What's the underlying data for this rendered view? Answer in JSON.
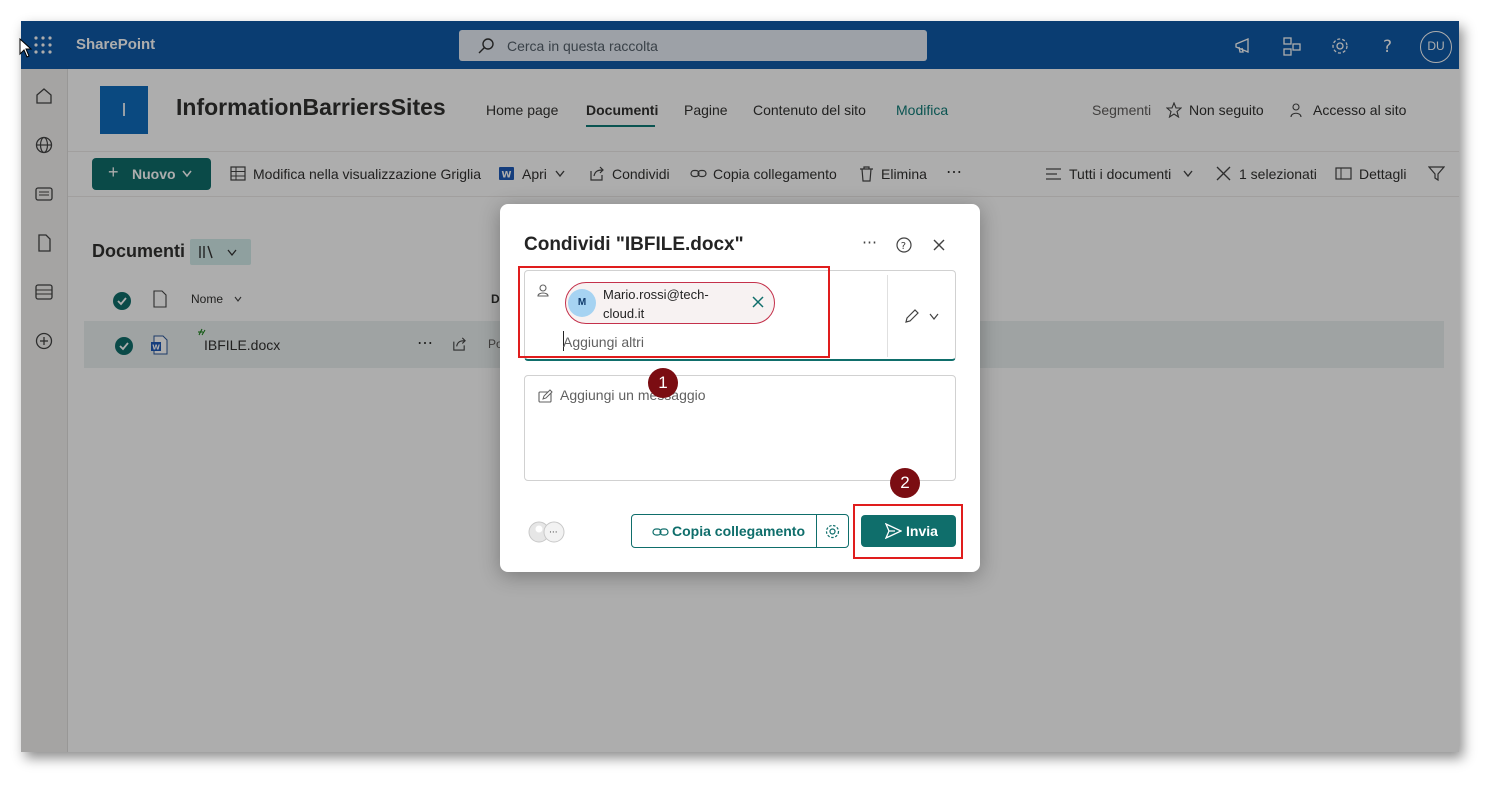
{
  "app": {
    "name": "SharePoint"
  },
  "search": {
    "placeholder": "Cerca in questa raccolta"
  },
  "user": {
    "initials": "DU"
  },
  "site": {
    "logo_letter": "I",
    "title": "InformationBarriersSites"
  },
  "nav": {
    "items": [
      "Home page",
      "Documenti",
      "Pagine",
      "Contenuto del sito",
      "Modifica"
    ],
    "active": "Documenti"
  },
  "header_right": {
    "segments": "Segmenti",
    "follow": "Non seguito",
    "access": "Accesso al sito"
  },
  "commands": {
    "new": "Nuovo",
    "grid_edit": "Modifica nella visualizzazione Griglia",
    "open": "Apri",
    "share": "Condividi",
    "copy_link": "Copia collegamento",
    "delete": "Elimina",
    "more": "⋯",
    "all_docs": "Tutti i documenti",
    "selected": "1 selezionati",
    "details": "Dettagli"
  },
  "library": {
    "title": "Documenti",
    "columns": {
      "name": "Nome",
      "modified_short": "D"
    },
    "rows": [
      {
        "name": "IBFILE.docx",
        "owner_short": "Po"
      }
    ]
  },
  "dialog": {
    "title": "Condividi \"IBFILE.docx\"",
    "recipient": {
      "initial": "M",
      "email": "Mario.rossi@tech-cloud.it"
    },
    "add_placeholder": "Aggiungi altri",
    "message_placeholder": "Aggiungi un messaggio",
    "copy_link": "Copia collegamento",
    "send": "Invia"
  },
  "annotations": {
    "step1": "1",
    "step2": "2"
  },
  "colors": {
    "suite_bar": "#0f5aa8",
    "accent": "#0f6e6b",
    "highlight": "#e01d1d",
    "badge": "#7b0d12"
  }
}
